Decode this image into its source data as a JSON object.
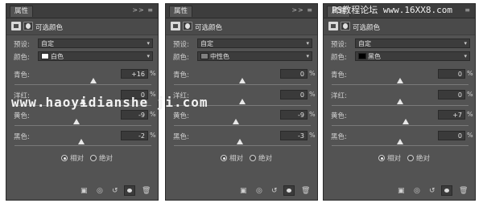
{
  "panels": [
    {
      "tab": "属性",
      "tb_controls": ">>  ≡",
      "header_label": "可选颜色",
      "preset_label": "预设:",
      "preset_value": "自定",
      "colors_label": "颜色:",
      "colors_value": "白色",
      "swatch": "#ffffff",
      "sliders": [
        {
          "label": "青色:",
          "value": "+16",
          "unit": "%",
          "fraction": 0.58
        },
        {
          "label": "洋红:",
          "value": "0",
          "unit": "%",
          "fraction": 0.5
        },
        {
          "label": "黄色:",
          "value": "-9",
          "unit": "%",
          "fraction": 0.45
        },
        {
          "label": "黑色:",
          "value": "-2",
          "unit": "%",
          "fraction": 0.49
        }
      ],
      "radio_relative": "相对",
      "radio_absolute": "绝对",
      "radio_selected": "relative"
    },
    {
      "tab": "属性",
      "tb_controls": ">>  ≡",
      "header_label": "可选颜色",
      "preset_label": "预设:",
      "preset_value": "自定",
      "colors_label": "颜色:",
      "colors_value": "中性色",
      "swatch": "#808080",
      "sliders": [
        {
          "label": "青色:",
          "value": "0",
          "unit": "%",
          "fraction": 0.5
        },
        {
          "label": "洋红:",
          "value": "0",
          "unit": "%",
          "fraction": 0.5
        },
        {
          "label": "黄色:",
          "value": "-9",
          "unit": "%",
          "fraction": 0.45
        },
        {
          "label": "黑色:",
          "value": "-3",
          "unit": "%",
          "fraction": 0.48
        }
      ],
      "radio_relative": "相对",
      "radio_absolute": "绝对",
      "radio_selected": "relative"
    },
    {
      "tab": "属性",
      "tb_controls": "≡",
      "header_label": "可选颜色",
      "preset_label": "预设:",
      "preset_value": "自定",
      "colors_label": "颜色:",
      "colors_value": "黑色",
      "swatch": "#000000",
      "sliders": [
        {
          "label": "青色:",
          "value": "0",
          "unit": "%",
          "fraction": 0.5
        },
        {
          "label": "洋红:",
          "value": "0",
          "unit": "%",
          "fraction": 0.5
        },
        {
          "label": "黄色:",
          "value": "+7",
          "unit": "%",
          "fraction": 0.54
        },
        {
          "label": "黑色:",
          "value": "0",
          "unit": "%",
          "fraction": 0.5
        }
      ],
      "radio_relative": "相对",
      "radio_absolute": "绝对",
      "radio_selected": "relative"
    }
  ],
  "watermarks": {
    "left": "www.haoyidianshe ji.com",
    "top_right": "PS教程论坛 www.16XX8.com"
  },
  "footer_icons": [
    "clip-to-layer-icon",
    "view-previous-icon",
    "reset-icon",
    "visibility-icon",
    "delete-icon"
  ]
}
